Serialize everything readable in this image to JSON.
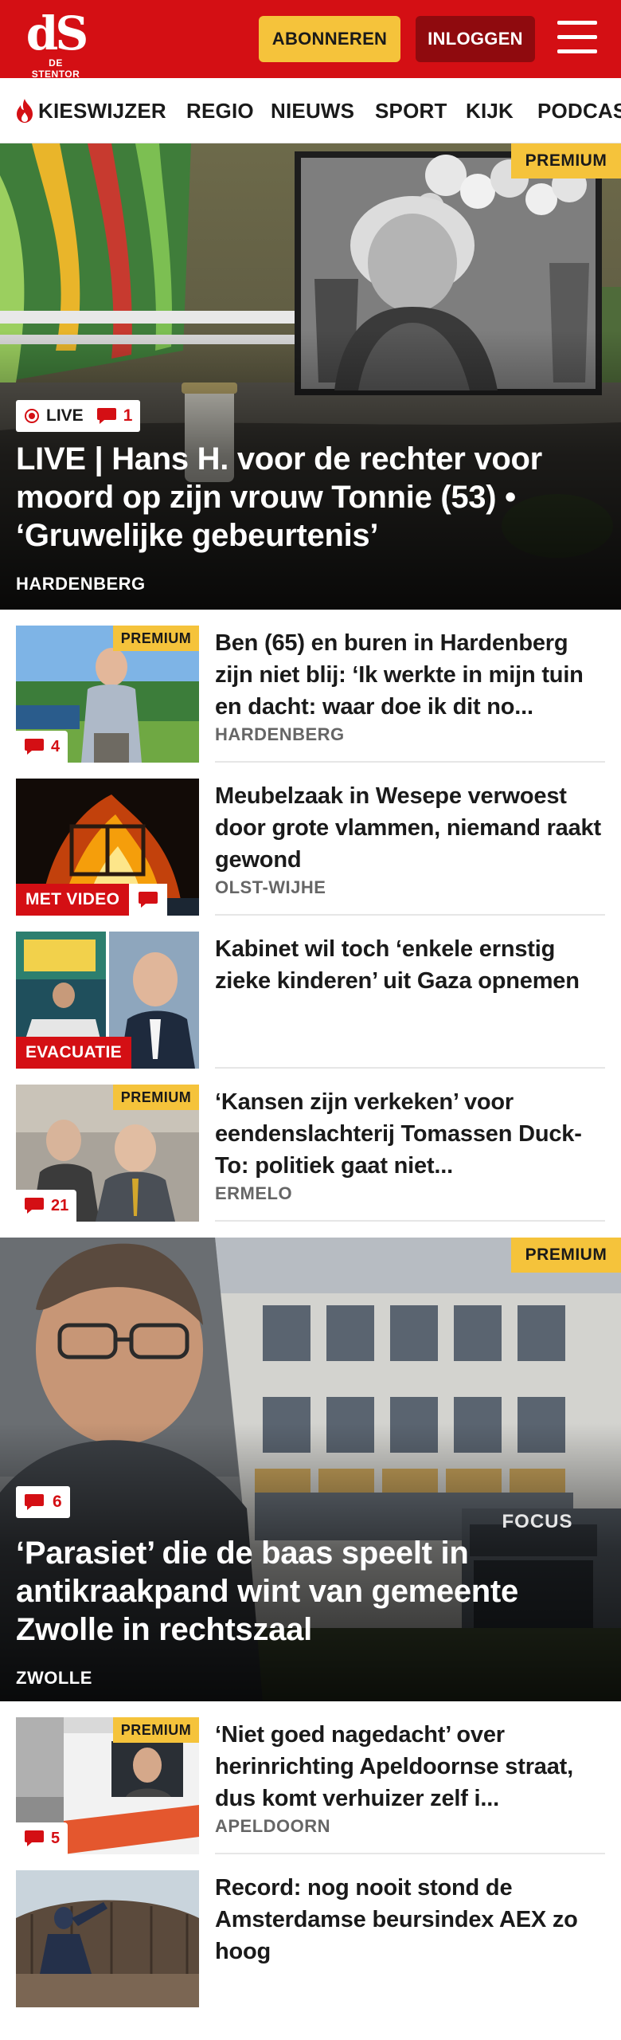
{
  "header": {
    "logo_mark": "dS",
    "logo_sub": "DE STENTOR",
    "subscribe_label": "ABONNEREN",
    "login_label": "INLOGGEN",
    "menu_icon": "hamburger-icon",
    "brand_color": "#d40f14"
  },
  "nav": {
    "items": [
      {
        "label": "KIESWIJZER",
        "icon": "flame-icon"
      },
      {
        "label": "REGIO"
      },
      {
        "label": "NIEUWS"
      },
      {
        "label": "SPORT"
      },
      {
        "label": "KIJK"
      },
      {
        "label": "PODCAS"
      }
    ]
  },
  "hero1": {
    "premium": "PREMIUM",
    "live_label": "LIVE",
    "comment_count": "1",
    "title": "LIVE | Hans H. voor de rechter voor moord op zijn vrouw Tonnie (53) • ‘Gruwelijke gebeurtenis’",
    "place": "HARDENBERG"
  },
  "articles": [
    {
      "premium": "PREMIUM",
      "comments": "4",
      "title": "Ben (65) en buren in Hardenberg zijn niet blij: ‘Ik werkte in mijn tuin en dacht: waar doe ik dit no...",
      "place": "HARDENBERG"
    },
    {
      "label": "MET VIDEO",
      "title": "Meubelzaak in Wesepe verwoest door grote vlammen, niemand raakt gewond",
      "place": "OLST-WIJHE"
    },
    {
      "label": "EVACUATIE",
      "title": "Kabinet wil toch ‘enkele ernstig zieke kinderen’ uit Gaza opnemen",
      "place": ""
    },
    {
      "premium": "PREMIUM",
      "comments": "21",
      "title": "‘Kansen zijn verkeken’ voor eendenslachterij Tomassen Duck-To: politiek gaat niet...",
      "place": "ERMELO"
    }
  ],
  "hero2": {
    "premium": "PREMIUM",
    "comment_count": "6",
    "sign_text": "FOCUS",
    "title": "‘Parasiet’ die de baas speelt in antikraakpand wint van gemeente Zwolle in rechtszaal",
    "place": "ZWOLLE"
  },
  "articles2": [
    {
      "premium": "PREMIUM",
      "comments": "5",
      "title": "‘Niet goed nagedacht’ over herinrichting Apeldoornse straat, dus komt verhuizer zelf i...",
      "place": "APELDOORN"
    },
    {
      "title": "Record: nog nooit stond de Amsterdamse beursindex AEX zo hoog",
      "place": ""
    }
  ]
}
